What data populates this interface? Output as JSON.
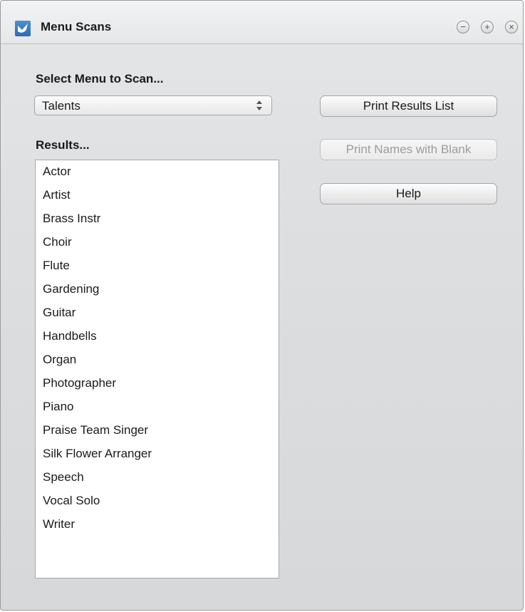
{
  "window": {
    "title": "Menu Scans",
    "controls": {
      "minimize": "−",
      "maximize": "+",
      "close": "×"
    }
  },
  "labels": {
    "select_menu": "Select Menu to Scan...",
    "results": "Results..."
  },
  "menu_select": {
    "value": "Talents"
  },
  "buttons": {
    "print_results": "Print Results List",
    "print_names": "Print Names with Blank",
    "help": "Help"
  },
  "results": [
    "Actor",
    "Artist",
    "Brass Instr",
    "Choir",
    "Flute",
    "Gardening",
    "Guitar",
    "Handbells",
    "Organ",
    "Photographer",
    "Piano",
    "Praise Team Singer",
    "Silk Flower Arranger",
    "Speech",
    "Vocal Solo",
    "Writer"
  ]
}
